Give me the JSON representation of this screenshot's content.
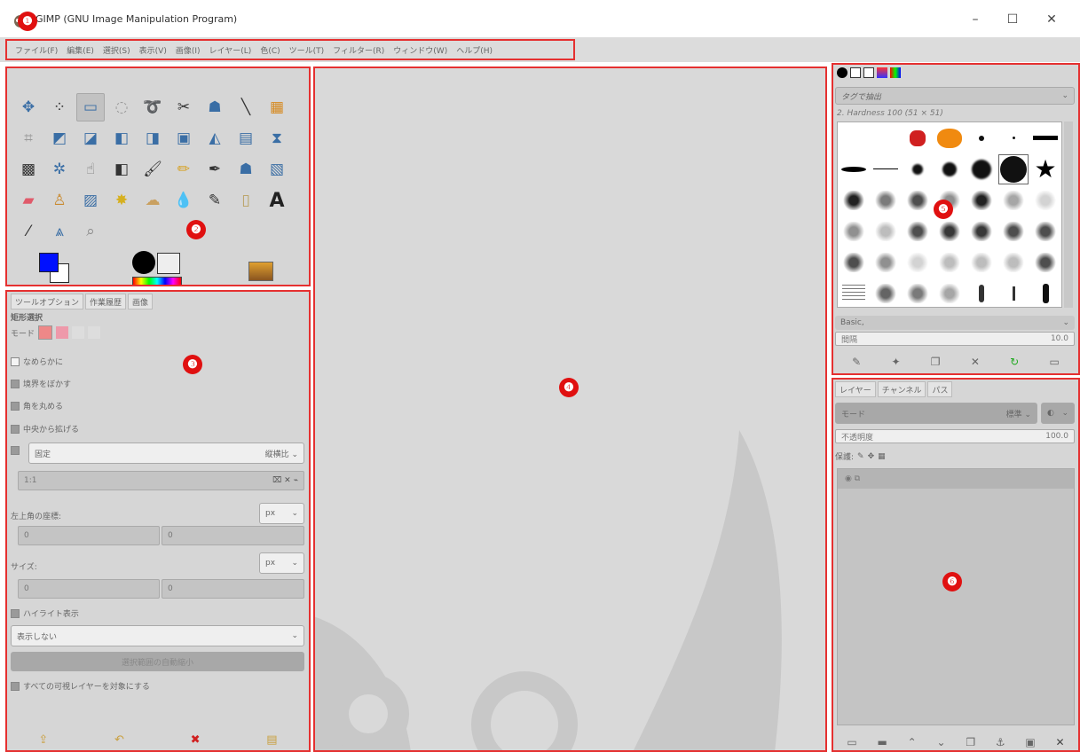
{
  "window": {
    "title": "GIMP (GNU Image Manipulation Program)",
    "minimize": "–",
    "maximize": "☐",
    "close": "✕"
  },
  "menu": [
    "ファイル(F)",
    "編集(E)",
    "選択(S)",
    "表示(V)",
    "画像(I)",
    "レイヤー(L)",
    "色(C)",
    "ツール(T)",
    "フィルター(R)",
    "ウィンドウ(W)",
    "ヘルプ(H)"
  ],
  "badges": [
    "❶",
    "❷",
    "❸",
    "❹",
    "❺",
    "❻"
  ],
  "tool_options": {
    "tabs": [
      "ツールオプション",
      "作業履歴",
      "画像"
    ],
    "title": "矩形選択",
    "mode_label": "モード",
    "antialias": "なめらかに",
    "feather": "境界をぼかす",
    "rounded": "角を丸める",
    "expand_center": "中央から拡げる",
    "fixed": "固定",
    "fixed_option": "縦横比",
    "ratio": "1:1",
    "position_label": "左上角の座標:",
    "position_x": "0",
    "position_y": "0",
    "size_label": "サイズ:",
    "size_w": "0",
    "size_h": "0",
    "unit": "px",
    "highlight": "ハイライト表示",
    "guides": "表示しない",
    "auto_shrink": "選択範囲の自動縮小",
    "sample_merged": "すべての可視レイヤーを対象にする"
  },
  "brushes": {
    "tag_placeholder": "タグで抽出",
    "brush_name": "2. Hardness 100 (51 × 51)",
    "preset": "Basic,",
    "spacing_label": "間隔",
    "spacing_value": "10.0"
  },
  "layers": {
    "tabs": [
      "レイヤー",
      "チャンネル",
      "パス"
    ],
    "mode": "モード",
    "mode_value": "標準",
    "opacity_label": "不透明度",
    "opacity_value": "100.0",
    "lock_label": "保護:"
  }
}
